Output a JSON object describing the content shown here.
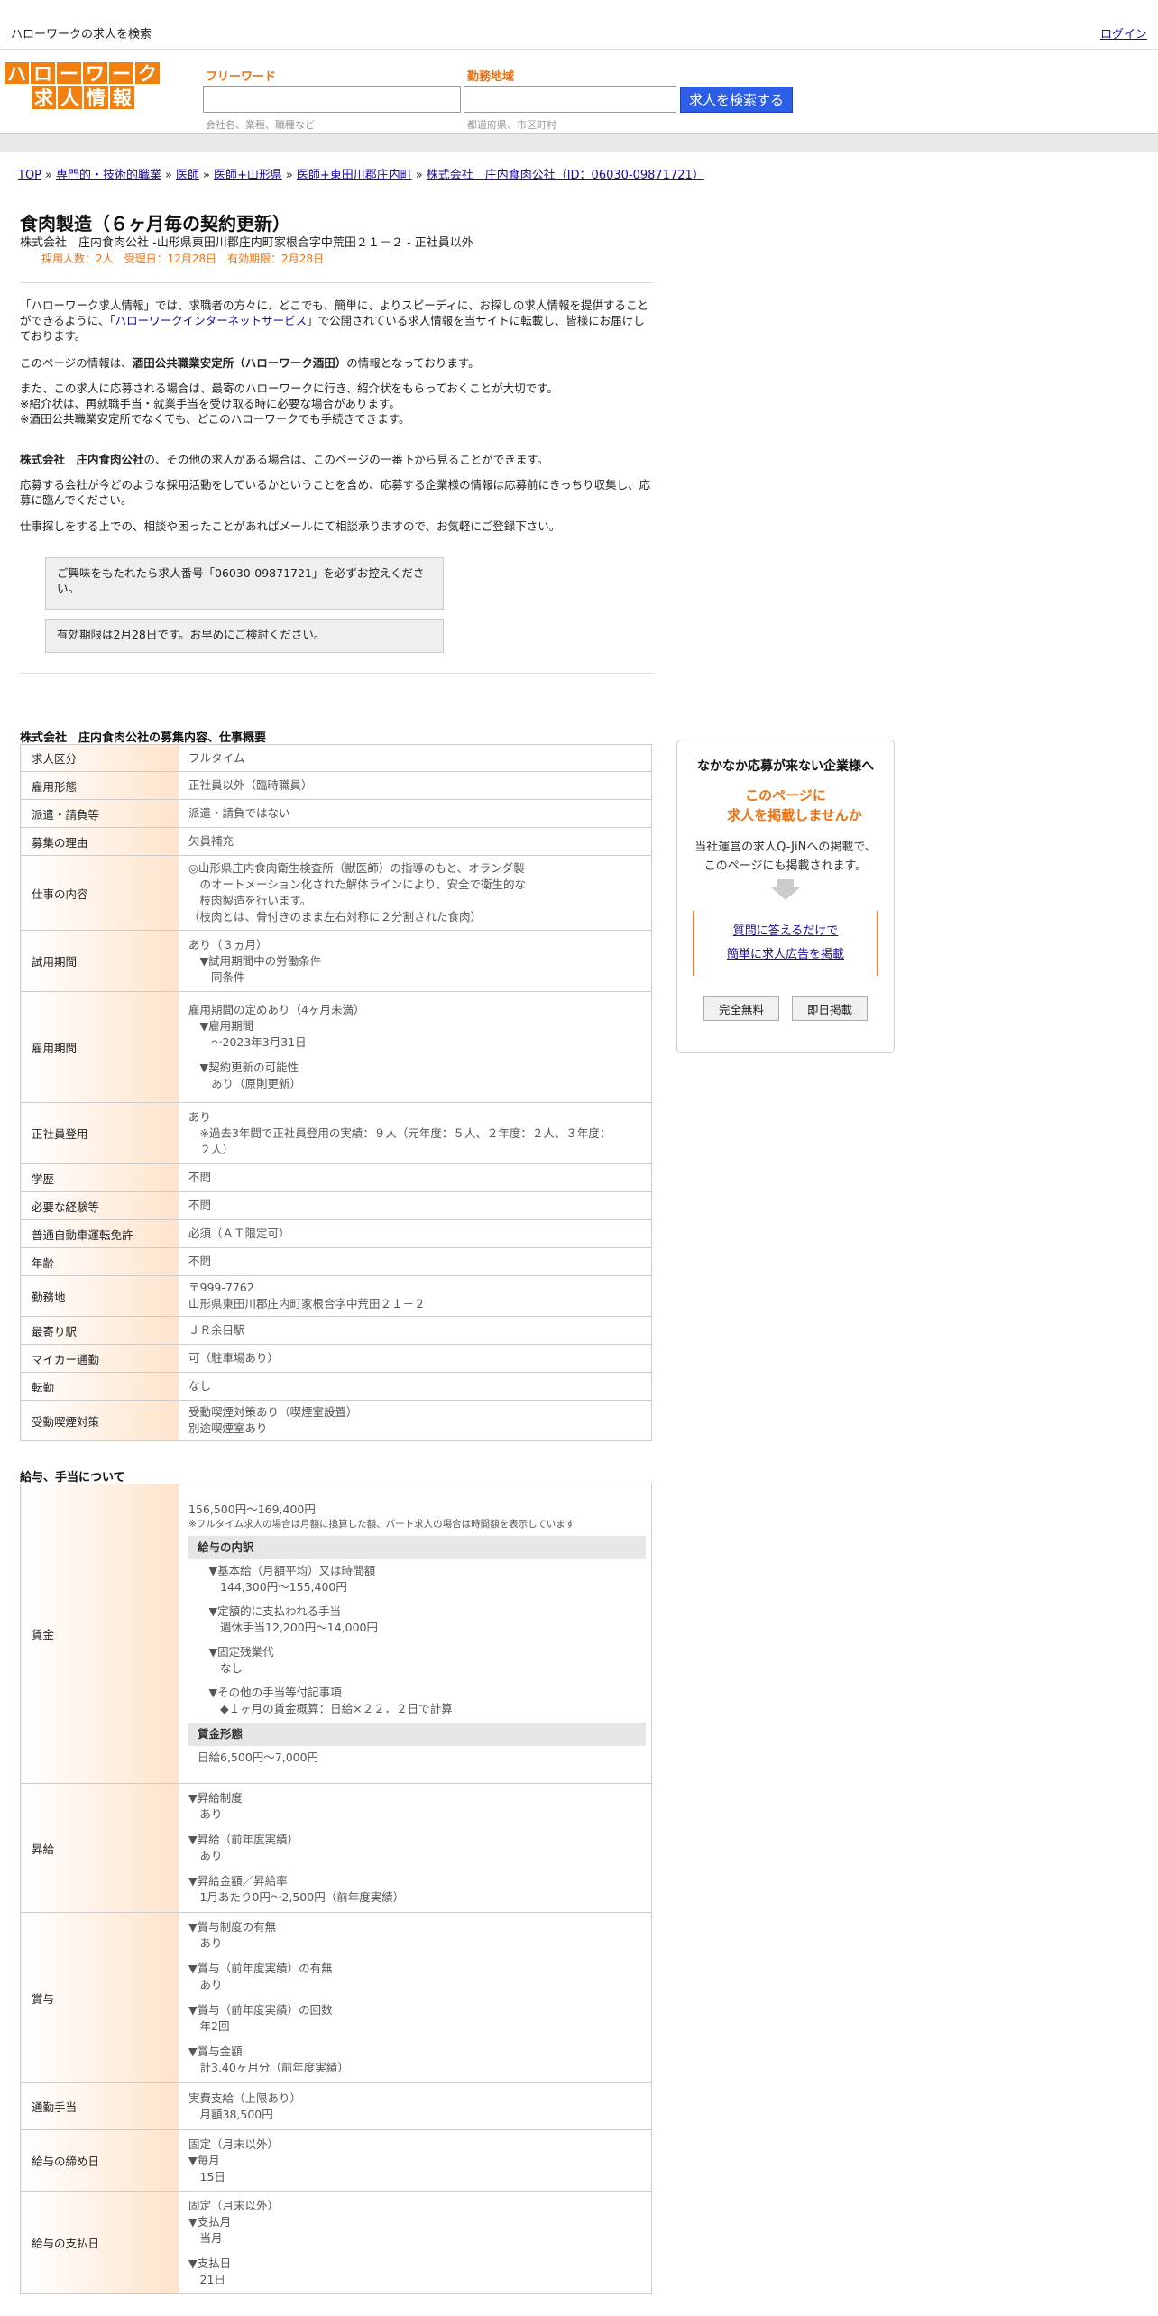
{
  "header": {
    "title": "ハローワークの求人を検索",
    "login": "ログイン"
  },
  "logo": {
    "row1": [
      "ハ",
      "ロ",
      "ー",
      "ワ",
      "ー",
      "ク"
    ],
    "row2": [
      "求",
      "人",
      "情",
      "報"
    ]
  },
  "search": {
    "keyword_label": "フリーワード",
    "keyword_hint": "会社名、業種、職種など",
    "area_label": "勤務地域",
    "area_hint": "都道府県、市区町村",
    "button": "求人を検索する"
  },
  "breadcrumb": [
    "TOP",
    "専門的・技術的職業",
    "医師",
    "医師+山形県",
    "医師+東田川郡庄内町",
    "株式会社　庄内食肉公社（ID：06030-09871721）"
  ],
  "job": {
    "title": "食肉製造（６ヶ月毎の契約更新）",
    "subtitle": "株式会社　庄内食肉公社 -山形県東田川郡庄内町家根合字中荒田２１－２ - 正社員以外",
    "meta": "採用人数：2人　受理日：12月28日　有効期限：2月28日"
  },
  "intro": {
    "p1_a": "「ハローワーク求人情報」では、求職者の方々に、どこでも、簡単に、よりスピーディに、お探しの求人情報を提供することができるように、「",
    "p1_link": "ハローワークインターネットサービス",
    "p1_b": "」で公開されている求人情報を当サイトに転載し、皆様にお届けしております。",
    "p2_a": "このページの情報は、",
    "p2_bold": "酒田公共職業安定所（ハローワーク酒田）",
    "p2_b": "の情報となっております。",
    "p3_l1": "また、この求人に応募される場合は、最寄のハローワークに行き、紹介状をもらっておくことが大切です。",
    "p3_l2": "※紹介状は、再就職手当・就業手当を受け取る時に必要な場合があります。",
    "p3_l3": "※酒田公共職業安定所でなくても、どこのハローワークでも手続きできます。",
    "p4_bold": "株式会社　庄内食肉公社",
    "p4_b": "の、その他の求人がある場合は、このページの一番下から見ることができます。",
    "p5": "応募する会社が今どのような採用活動をしているかということを含め、応募する企業様の情報は応募前にきっちり収集し、応募に臨んでください。",
    "p6": "仕事探しをする上での、相談や困ったことがあればメールにて相談承りますので、お気軽にご登録下さい。"
  },
  "notices": [
    "ご興味をもたれたら求人番号「06030-09871721」を必ずお控えください。",
    "有効期限は2月28日です。お早めにご検討ください。"
  ],
  "summary": {
    "title": "株式会社　庄内食肉公社の募集内容、仕事概要",
    "rows": [
      {
        "label": "求人区分",
        "value": "フルタイム"
      },
      {
        "label": "雇用形態",
        "value": "正社員以外（臨時職員）"
      },
      {
        "label": "派遣・請負等",
        "value": "派遣・請負ではない"
      },
      {
        "label": "募集の理由",
        "value": "欠員補充"
      },
      {
        "label": "仕事の内容",
        "lines": [
          "◎山形県庄内食肉衛生検査所（獣医師）の指導のもと、オランダ製",
          "　のオートメーション化された解体ラインにより、安全で衛生的な",
          "　枝肉製造を行います。",
          "（枝肉とは、骨付きのまま左右対称に２分割された食肉）"
        ]
      },
      {
        "label": "試用期間",
        "lines": [
          "あり（３ヵ月）",
          "　▼試用期間中の労働条件",
          "　　同条件"
        ]
      },
      {
        "label": "雇用期間",
        "lines": [
          "雇用期間の定めあり（4ヶ月未満）",
          "　▼雇用期間",
          "　　〜2023年3月31日",
          "",
          "　▼契約更新の可能性",
          "　　あり（原則更新）"
        ]
      },
      {
        "label": "正社員登用",
        "lines": [
          "あり",
          "　※過去3年間で正社員登用の実績：９人（元年度：５人、２年度：２人、３年度：",
          "　２人）"
        ]
      },
      {
        "label": "学歴",
        "value": "不問"
      },
      {
        "label": "必要な経験等",
        "value": "不問"
      },
      {
        "label": "普通自動車運転免許",
        "value": "必須（ＡＴ限定可）"
      },
      {
        "label": "年齢",
        "value": "不問"
      },
      {
        "label": "勤務地",
        "lines": [
          "〒999-7762",
          "山形県東田川郡庄内町家根合字中荒田２１－２"
        ]
      },
      {
        "label": "最寄り駅",
        "value": "ＪＲ余目駅"
      },
      {
        "label": "マイカー通勤",
        "value": "可（駐車場あり）"
      },
      {
        "label": "転勤",
        "value": "なし"
      },
      {
        "label": "受動喫煙対策",
        "lines": [
          "受動喫煙対策あり（喫煙室設置）",
          "別途喫煙室あり"
        ]
      }
    ]
  },
  "salary": {
    "title": "給与、手当について",
    "wage_label": "賃金",
    "wage_range": "156,500円〜169,400円",
    "wage_note": "※フルタイム求人の場合は月額に換算した額、パート求人の場合は時間額を表示しています",
    "breakdown_title": "給与の内訳",
    "breakdown": [
      "　▼基本給（月額平均）又は時間額",
      "　　144,300円〜155,400円",
      "",
      "　▼定額的に支払われる手当",
      "　　週休手当12,200円〜14,000円",
      "",
      "　▼固定残業代",
      "　　なし",
      "",
      "　▼その他の手当等付記事項",
      "　　◆１ヶ月の賃金概算：日給×２２．２日で計算"
    ],
    "form_title": "賃金形態",
    "form_value": "日給6,500円〜7,000円",
    "rows": [
      {
        "label": "昇給",
        "lines": [
          "▼昇給制度",
          "　あり",
          "",
          "▼昇給（前年度実績）",
          "　あり",
          "",
          "▼昇給金額／昇給率",
          "　1月あたり0円〜2,500円（前年度実績）"
        ]
      },
      {
        "label": "賞与",
        "lines": [
          "▼賞与制度の有無",
          "　あり",
          "",
          "▼賞与（前年度実績）の有無",
          "　あり",
          "",
          "▼賞与（前年度実績）の回数",
          "　年2回",
          "",
          "▼賞与金額",
          "　計3.40ヶ月分（前年度実績）"
        ]
      },
      {
        "label": "通勤手当",
        "lines": [
          "実費支給（上限あり）",
          "　月額38,500円"
        ]
      },
      {
        "label": "給与の締め日",
        "lines": [
          "固定（月末以外）",
          "▼毎月",
          "　15日"
        ]
      },
      {
        "label": "給与の支払日",
        "lines": [
          "固定（月末以外）",
          "▼支払月",
          "　当月",
          "",
          "▼支払日",
          "　21日"
        ]
      }
    ]
  },
  "side": {
    "heading": "なかなか応募が来ない企業様へ",
    "orange_l1": "このページに",
    "orange_l2": "求人を掲載しませんか",
    "text_l1": "当社運営の求人Q-JiNへの掲載で、",
    "text_l2": "このページにも掲載されます。",
    "link1": "質問に答えるだけで",
    "link2": "簡単に求人広告を掲載",
    "btn1": "完全無料",
    "btn2": "即日掲載"
  }
}
